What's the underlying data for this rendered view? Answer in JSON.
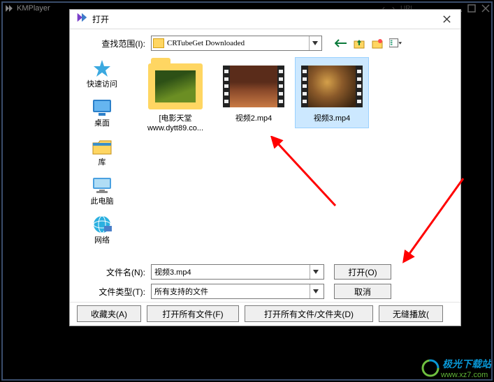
{
  "kmp": {
    "name": "KMPlayer"
  },
  "dialog": {
    "title": "打开",
    "lookin_label": "查找范围(I):",
    "lookin_value": "CRTubeGet Downloaded",
    "filename_label": "文件名(N):",
    "filename_value": "视频3.mp4",
    "filetype_label": "文件类型(T):",
    "filetype_value": "所有支持的文件",
    "open_btn": "打开(O)",
    "cancel_btn": "取消"
  },
  "places": {
    "quick": "快速访问",
    "desktop": "桌面",
    "libraries": "库",
    "thispc": "此电脑",
    "network": "网络"
  },
  "files": {
    "folder1_l1": "[电影天堂",
    "folder1_l2": "www.dytt89.co...",
    "video2": "视频2.mp4",
    "video3": "视频3.mp4"
  },
  "bottom": {
    "fav": "收藏夹(A)",
    "openall": "打开所有文件(F)",
    "openallff": "打开所有文件/文件夹(D)",
    "seamless": "无缝播放("
  },
  "watermark": {
    "name": "极光下载站",
    "url": "www.xz7.com"
  }
}
